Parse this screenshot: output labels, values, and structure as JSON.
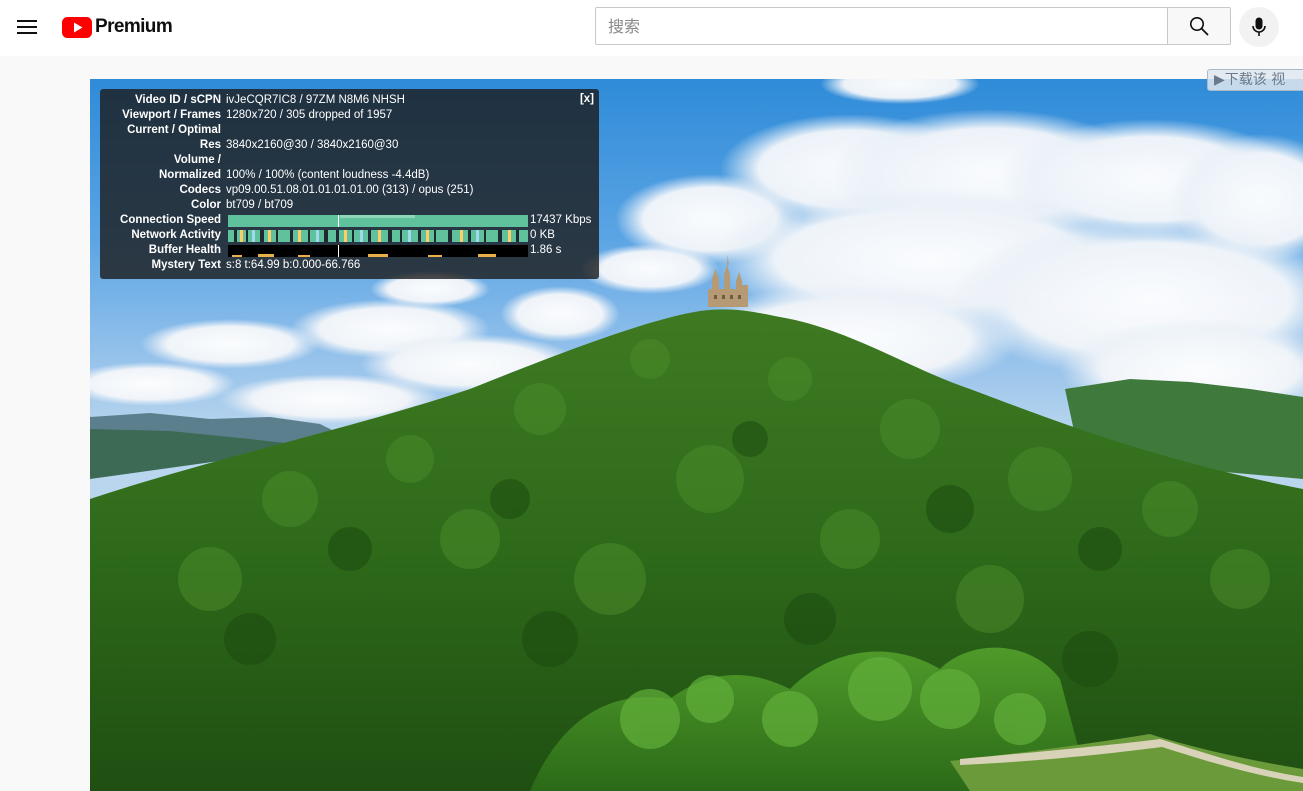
{
  "header": {
    "logo_text": "Premium",
    "search_placeholder": "搜索"
  },
  "stats": {
    "close_label": "[x]",
    "rows": [
      {
        "label": "Video ID / sCPN",
        "value": "ivJeCQR7IC8 / 97ZM N8M6 NHSH"
      },
      {
        "label": "Viewport / Frames",
        "value": "1280x720 / 305 dropped of 1957"
      },
      {
        "label": "Current / Optimal",
        "value": ""
      },
      {
        "label": "Res",
        "value": "3840x2160@30 / 3840x2160@30"
      },
      {
        "label": "Volume /",
        "value": ""
      },
      {
        "label": "Normalized",
        "value": "100% / 100% (content loudness -4.4dB)"
      },
      {
        "label": "Codecs",
        "value": "vp09.00.51.08.01.01.01.01.00 (313) / opus (251)"
      },
      {
        "label": "Color",
        "value": "bt709 / bt709"
      },
      {
        "label": "Connection Speed",
        "value": "17437 Kbps"
      },
      {
        "label": "Network Activity",
        "value": "0 KB"
      },
      {
        "label": "Buffer Health",
        "value": "1.86 s"
      },
      {
        "label": "Mystery Text",
        "value": "s:8 t:64.99 b:0.000-66.766"
      }
    ]
  },
  "download_tab": {
    "label": "▶下载该 视"
  },
  "colors": {
    "youtube_red": "#ff0000",
    "connection_graph": "#5fc29d",
    "network_graph": "#ffcc66"
  }
}
